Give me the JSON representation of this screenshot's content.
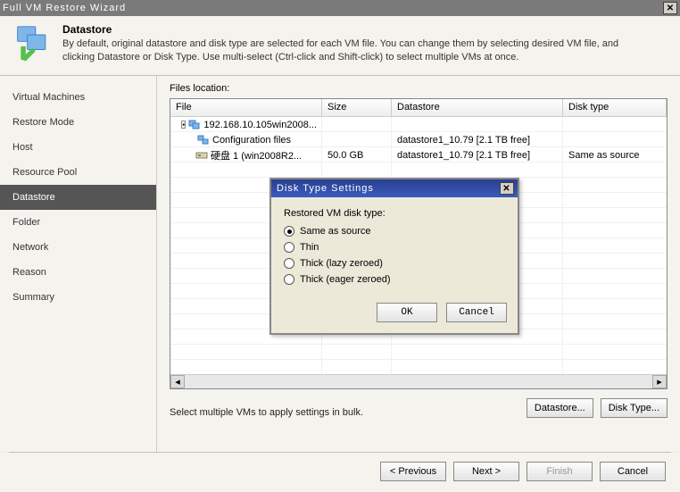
{
  "window": {
    "title": "Full VM Restore Wizard"
  },
  "header": {
    "title": "Datastore",
    "desc": "By default, original datastore and disk type are selected for each VM file. You can change them by selecting desired VM file, and clicking Datastore or Disk Type. Use multi-select (Ctrl-click and Shift-click) to select multiple VMs at once."
  },
  "sidebar": {
    "items": [
      {
        "label": "Virtual Machines"
      },
      {
        "label": "Restore Mode"
      },
      {
        "label": "Host"
      },
      {
        "label": "Resource Pool"
      },
      {
        "label": "Datastore"
      },
      {
        "label": "Folder"
      },
      {
        "label": "Network"
      },
      {
        "label": "Reason"
      },
      {
        "label": "Summary"
      }
    ],
    "active_index": 4
  },
  "content": {
    "files_label": "Files location:",
    "columns": {
      "file": "File",
      "size": "Size",
      "datastore": "Datastore",
      "disktype": "Disk type"
    },
    "rows": [
      {
        "file": "192.168.10.105win2008...",
        "size": "",
        "datastore": "",
        "disktype": "",
        "level": 0,
        "icon": "vm",
        "expand": "open"
      },
      {
        "file": "Configuration files",
        "size": "",
        "datastore": "datastore1_10.79 [2.1 TB free]",
        "disktype": "",
        "level": 1,
        "icon": "config"
      },
      {
        "file": "硬盘 1 (win2008R2...",
        "size": "50.0 GB",
        "datastore": "datastore1_10.79 [2.1 TB free]",
        "disktype": "Same as source",
        "level": 1,
        "icon": "disk"
      }
    ],
    "hint": "Select multiple VMs to apply settings in bulk.",
    "buttons": {
      "datastore": "Datastore...",
      "disktype": "Disk Type..."
    }
  },
  "dialog": {
    "title": "Disk Type Settings",
    "label": "Restored VM disk type:",
    "options": [
      {
        "label": "Same as source",
        "checked": true
      },
      {
        "label": "Thin",
        "checked": false
      },
      {
        "label": "Thick (lazy zeroed)",
        "checked": false
      },
      {
        "label": "Thick (eager zeroed)",
        "checked": false
      }
    ],
    "ok": "OK",
    "cancel": "Cancel"
  },
  "footer": {
    "previous": "< Previous",
    "next": "Next >",
    "finish": "Finish",
    "cancel": "Cancel"
  }
}
